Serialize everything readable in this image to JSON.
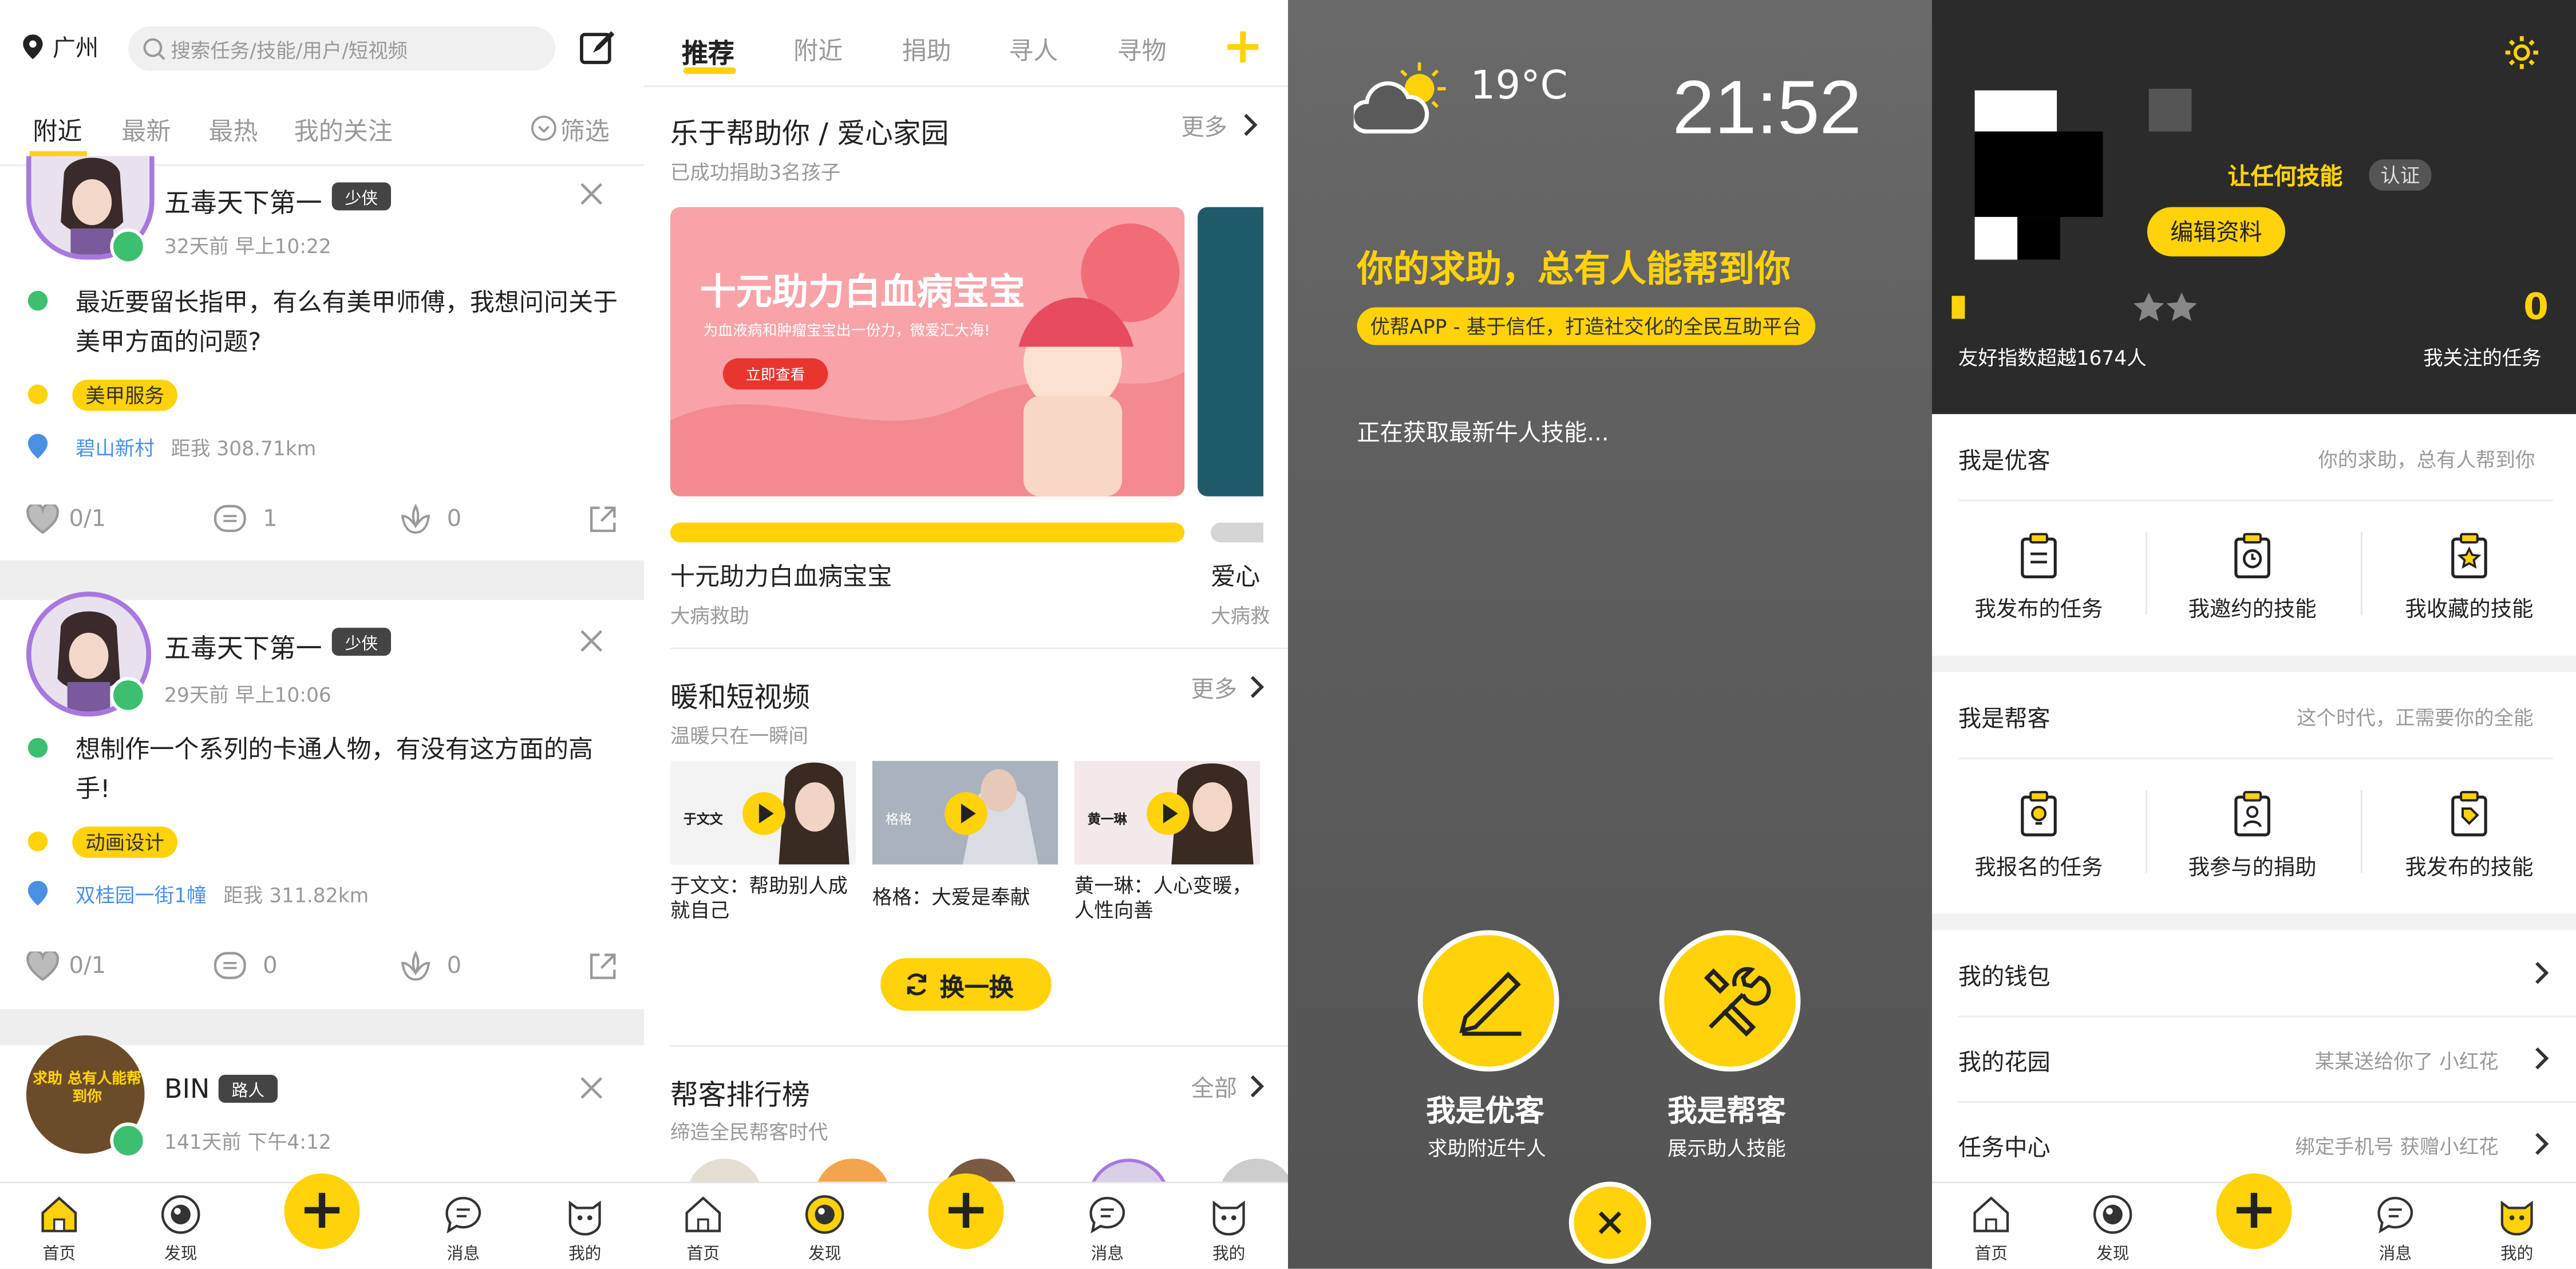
{
  "p1": {
    "city": "广州",
    "search_placeholder": "搜索任务/技能/用户/短视频",
    "tabs": [
      "附近",
      "最新",
      "最热",
      "我的关注"
    ],
    "filter_label": "筛选",
    "posts": [
      {
        "name": "五毒天下第一",
        "badge": "少侠",
        "time": "32天前 早上10:22",
        "text": "最近要留长指甲，有么有美甲师傅，我想问问关于美甲方面的问题?",
        "tag": "美甲服务",
        "place": "碧山新村",
        "distance": "距我 308.71km",
        "likes": "0/1",
        "comments": "1",
        "flowers": "0"
      },
      {
        "name": "五毒天下第一",
        "badge": "少侠",
        "time": "29天前 早上10:06",
        "text": "想制作一个系列的卡通人物，有没有这方面的高手!",
        "tag": "动画设计",
        "place": "双桂园一街1幢",
        "distance": "距我 311.82km",
        "likes": "0/1",
        "comments": "0",
        "flowers": "0"
      },
      {
        "name": "BIN",
        "badge": "路人",
        "time": "141天前 下午4:12",
        "avatar_text": "求助 总有人能帮到你"
      }
    ]
  },
  "p2": {
    "tabs": [
      "推荐",
      "附近",
      "捐助",
      "寻人",
      "寻物"
    ],
    "section1_title": "乐于帮助你 / 爱心家园",
    "section1_sub": "已成功捐助3名孩子",
    "more": "更多",
    "banner_title": "十元助力白血病宝宝",
    "banner_sub": "为血液病和肿瘤宝宝出一份力，微爱汇大海!",
    "banner_btn": "立即查看",
    "card1_title": "十元助力白血病宝宝",
    "card1_sub": "大病救助",
    "card2_title": "爱心",
    "card2_sub": "大病救",
    "section2_title": "暖和短视频",
    "section2_sub": "温暖只在一瞬间",
    "videos": [
      {
        "thumb_name": "于文文",
        "caption": "于文文：帮助别人成就自己"
      },
      {
        "thumb_name": "格格",
        "caption": "格格：大爱是奉献"
      },
      {
        "thumb_name": "黄一琳",
        "caption": "黄一琳：人心变暖，人性向善"
      }
    ],
    "refresh_label": "换一换",
    "section3_title": "帮客排行榜",
    "section3_sub": "缔造全民帮客时代",
    "all": "全部"
  },
  "p3": {
    "temperature": "19°C",
    "time": "21:52",
    "slogan": "你的求助，总有人能帮到你",
    "sub_slogan": "优帮APP - 基于信任，打造社交化的全民互助平台",
    "loading": "正在获取最新牛人技能...",
    "option1_title": "我是优客",
    "option1_sub": "求助附近牛人",
    "option2_title": "我是帮客",
    "option2_sub": "展示助人技能"
  },
  "p4": {
    "skill_text": "让任何技能",
    "verify": "认证",
    "edit_profile": "编辑资料",
    "friend_index": "友好指数超越1674人",
    "follow_count": "0",
    "follow_label": "我关注的任务",
    "section1_title": "我是优客",
    "section1_sub": "你的求助，总有人帮到你",
    "section1_items": [
      "我发布的任务",
      "我邀约的技能",
      "我收藏的技能"
    ],
    "section2_title": "我是帮客",
    "section2_sub": "这个时代，正需要你的全能",
    "section2_items": [
      "我报名的任务",
      "我参与的捐助",
      "我发布的技能"
    ],
    "rows": [
      {
        "label": "我的钱包",
        "hint": ""
      },
      {
        "label": "我的花园",
        "hint": "某某送给你了 小红花"
      },
      {
        "label": "任务中心",
        "hint": "绑定手机号 获赠小红花"
      }
    ]
  },
  "tabbar": [
    "首页",
    "发现",
    "消息",
    "我的"
  ],
  "colors": {
    "accent": "#ffd20a",
    "link": "#4a90e2",
    "dark": "#2b2b2b"
  }
}
